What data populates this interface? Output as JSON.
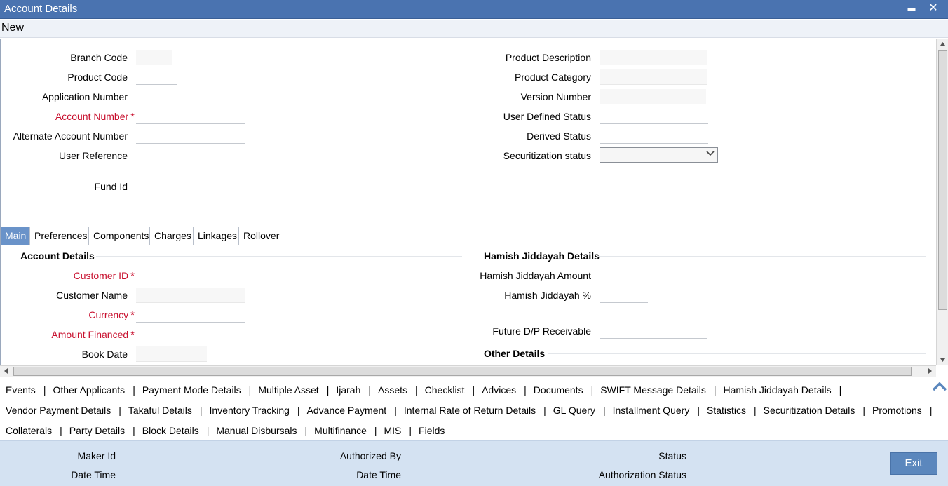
{
  "window": {
    "title": "Account Details",
    "minimize_label": "▬",
    "close_label": "✕"
  },
  "toolbar": {
    "new_label": "New"
  },
  "header_fields": {
    "branch_code": "Branch Code",
    "product_code": "Product Code",
    "application_number": "Application Number",
    "account_number": "Account Number",
    "alternate_account_number": "Alternate Account Number",
    "user_reference": "User Reference",
    "fund_id": "Fund Id",
    "product_description": "Product Description",
    "product_category": "Product Category",
    "version_number": "Version Number",
    "user_defined_status": "User Defined Status",
    "derived_status": "Derived Status",
    "securitization_status": "Securitization status",
    "securitization_status_value": ""
  },
  "required_marker": "*",
  "tabs": [
    {
      "label": "Main",
      "active": true
    },
    {
      "label": "Preferences",
      "active": false
    },
    {
      "label": "Components",
      "active": false
    },
    {
      "label": "Charges",
      "active": false
    },
    {
      "label": "Linkages",
      "active": false
    },
    {
      "label": "Rollover",
      "active": false
    }
  ],
  "main_tab": {
    "account_details_heading": "Account Details",
    "customer_id": "Customer ID",
    "customer_name": "Customer Name",
    "currency": "Currency",
    "amount_financed": "Amount Financed",
    "book_date": "Book Date",
    "hamish_heading": "Hamish Jiddayah Details",
    "hamish_amount": "Hamish Jiddayah Amount",
    "hamish_percent": "Hamish Jiddayah %",
    "future_dp_receivable": "Future D/P Receivable",
    "other_details_heading": "Other Details"
  },
  "link_rows": [
    [
      "Events",
      "Other Applicants",
      "Payment Mode Details",
      "Multiple Asset",
      "Ijarah",
      "Assets",
      "Checklist",
      "Advices",
      "Documents",
      "SWIFT Message Details",
      "Hamish Jiddayah Details"
    ],
    [
      "Vendor Payment Details",
      "Takaful Details",
      "Inventory Tracking",
      "Advance Payment",
      "Internal Rate of Return Details",
      "GL Query",
      "Installment Query",
      "Statistics",
      "Securitization Details",
      "Promotions"
    ],
    [
      "Collaterals",
      "Party Details",
      "Block Details",
      "Manual Disbursals",
      "Multifinance",
      "MIS",
      "Fields"
    ]
  ],
  "link_separator": "|",
  "footer": {
    "maker_id": "Maker Id",
    "date_time_1": "Date Time",
    "authorized_by": "Authorized By",
    "date_time_2": "Date Time",
    "status": "Status",
    "authorization_status": "Authorization Status",
    "exit_label": "Exit"
  },
  "colors": {
    "title_bar": "#4a73b0",
    "active_tab": "#6a93c9",
    "required": "#c8102e",
    "footer": "#d4e2f2",
    "exit_button": "#5b87bd"
  }
}
